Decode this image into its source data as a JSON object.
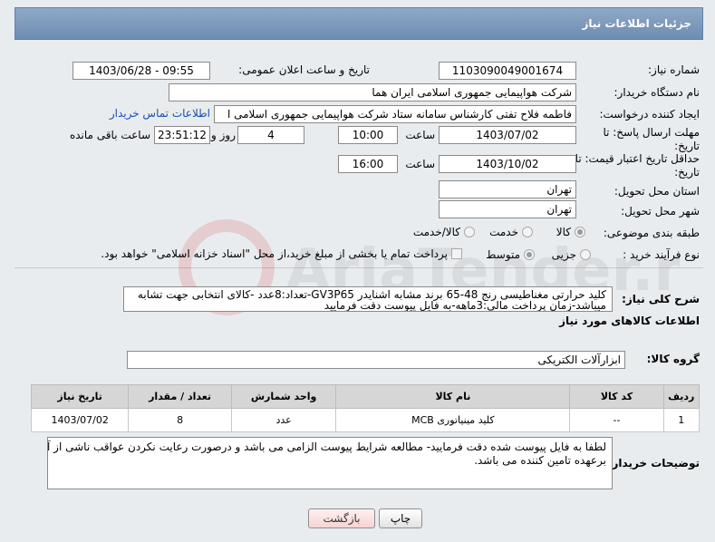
{
  "header": {
    "title": "جزئیات اطلاعات نیاز"
  },
  "need_number": {
    "label": "شماره نیاز:",
    "value": "1103090049001674"
  },
  "announce": {
    "label": "تاریخ و ساعت اعلان عمومی:",
    "value": "1403/06/28 - 09:55"
  },
  "buyer_org": {
    "label": "نام دستگاه خریدار:",
    "value": "شرکت هواپیمایی جمهوری اسلامی ایران هما"
  },
  "requester": {
    "label": "ایجاد کننده درخواست:",
    "value": "فاطمه فلاح تفتی کارشناس سامانه ستاد شرکت هواپیمایی جمهوری اسلامی ا",
    "contact_link": "اطلاعات تماس خریدار"
  },
  "reply_deadline": {
    "label_line1": "مهلت ارسال پاسخ: تا",
    "label_line2": "تاریخ:",
    "date": "1403/07/02",
    "time_label": "ساعت",
    "time": "10:00",
    "days": "4",
    "days_label": "روز و",
    "remaining": "23:51:12",
    "remaining_label": "ساعت باقی مانده"
  },
  "price_validity": {
    "label_line1": "حداقل تاریخ اعتبار قیمت: تا",
    "label_line2": "تاریخ:",
    "date": "1403/10/02",
    "time_label": "ساعت",
    "time": "16:00"
  },
  "province": {
    "label": "استان محل تحویل:",
    "value": "تهران"
  },
  "city": {
    "label": "شهر محل تحویل:",
    "value": "تهران"
  },
  "category": {
    "label": "طبقه بندی موضوعی:",
    "options": [
      "کالا",
      "خدمت",
      "کالا/خدمت"
    ]
  },
  "process": {
    "label": "نوع فرآیند خرید :",
    "options": [
      "جزیی",
      "متوسط"
    ],
    "note": "پرداخت تمام یا بخشی از مبلغ خرید،از محل \"اسناد خزانه اسلامی\" خواهد بود."
  },
  "general_desc": {
    "label": "شرح کلی نیاز:",
    "line1": "کلید حرارتی مغناطیسی رنج 48-65 برند مشابه اشنایدر GV3P65-تعداد:8عدد -کالای انتخابی جهت تشابه",
    "line2": "میباشد-زمان پرداخت مالی:3ماهه-به فایل پیوست دقت فرمایید"
  },
  "goods_section": {
    "title": "اطلاعات کالاهای مورد نیاز"
  },
  "goods_group": {
    "label": "گروه کالا:",
    "value": "ابزارآلات الکتریکی"
  },
  "table": {
    "headers": [
      "ردیف",
      "کد کالا",
      "نام کالا",
      "واحد شمارش",
      "تعداد / مقدار",
      "تاریخ نیاز"
    ],
    "rows": [
      [
        "1",
        "--",
        "کلید مینیاتوری MCB",
        "عدد",
        "8",
        "1403/07/02"
      ]
    ]
  },
  "buyer_notes": {
    "label": "توضیحات خریدار:",
    "line1": "لطفا به فایل پیوست شده دقت فرمایید- مطالعه شرایط پیوست الزامی می باشد و درصورت رعایت نکردن عواقب ناشی از آن",
    "line2": "برعهده تامین کننده می باشد."
  },
  "buttons": {
    "print": "چاپ",
    "back": "بازگشت"
  },
  "watermark": {
    "text": "AriaTender.neT"
  },
  "colors": {
    "header_bg": "#7f9bbd",
    "link": "#1a4fb3",
    "back_button_bg": "#f6d4d4"
  }
}
